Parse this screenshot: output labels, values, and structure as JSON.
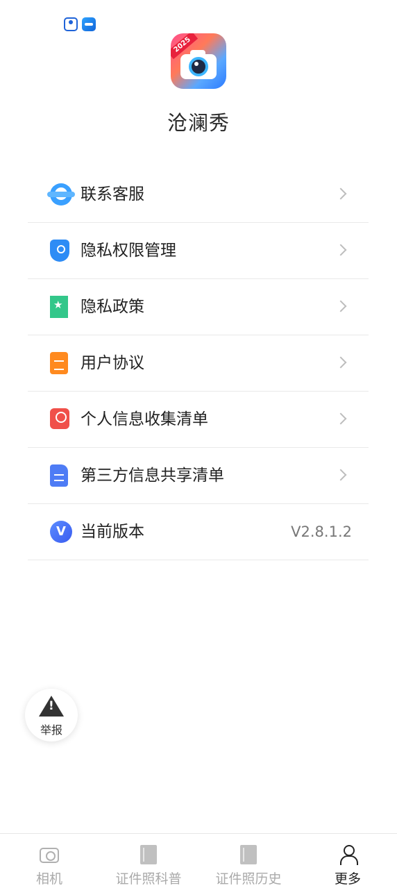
{
  "status_bar": {
    "icons": [
      "map-pin-app-icon",
      "ticket-app-icon"
    ]
  },
  "app": {
    "logo_badge": "2025",
    "name": "沧澜秀"
  },
  "menu": {
    "items": [
      {
        "label": "联系客服",
        "icon": "customer-service-icon"
      },
      {
        "label": "隐私权限管理",
        "icon": "shield-key-icon"
      },
      {
        "label": "隐私政策",
        "icon": "bookmark-star-icon"
      },
      {
        "label": "用户协议",
        "icon": "document-icon"
      },
      {
        "label": "个人信息收集清单",
        "icon": "person-card-icon"
      },
      {
        "label": "第三方信息共享清单",
        "icon": "file-list-icon"
      },
      {
        "label": "当前版本",
        "icon": "version-icon",
        "value": "V2.8.1.2"
      }
    ]
  },
  "report": {
    "label": "举报",
    "icon": "warning-triangle-icon"
  },
  "bottom_nav": {
    "items": [
      {
        "label": "相机",
        "icon": "camera-icon",
        "active": false
      },
      {
        "label": "证件照科普",
        "icon": "book-icon",
        "active": false
      },
      {
        "label": "证件照历史",
        "icon": "book-icon",
        "active": false
      },
      {
        "label": "更多",
        "icon": "user-icon",
        "active": true
      }
    ]
  },
  "colors": {
    "accent_blue": "#2e8cf5",
    "divider": "#e9e9e9",
    "text_primary": "#222222",
    "text_muted": "#aaaaaa"
  }
}
